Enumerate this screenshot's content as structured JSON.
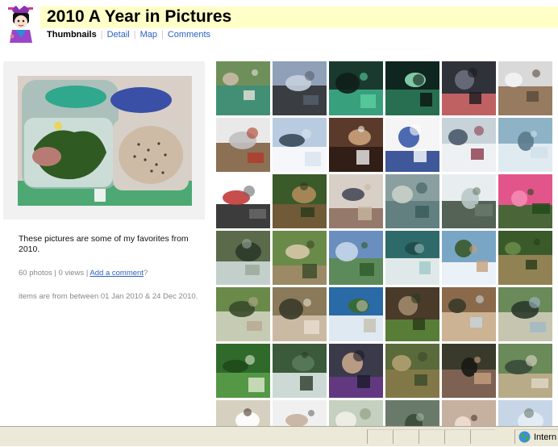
{
  "album": {
    "title": "2010 A Year in Pictures"
  },
  "nav": {
    "thumbnails": "Thumbnails",
    "detail": "Detail",
    "map": "Map",
    "comments": "Comments"
  },
  "sidebar": {
    "description": "These pictures are some of my favorites from 2010.",
    "photo_count": "60 photos",
    "separator": "|",
    "view_count": "0 views",
    "add_comment": "Add a comment",
    "question_mark": "?",
    "date_range": "items are from between 01 Jan 2010 & 24 Dec 2010."
  },
  "status": {
    "zone_label": "Intern"
  },
  "thumbnails": [
    {
      "subject": "food-tubs"
    },
    {
      "subject": "bare-trees-dusk"
    },
    {
      "subject": "green-table-night"
    },
    {
      "subject": "green-porch-night"
    },
    {
      "subject": "sunset-town"
    },
    {
      "subject": "snowy-deck-chairs"
    },
    {
      "subject": "snowy-deck-grill"
    },
    {
      "subject": "snowy-trees"
    },
    {
      "subject": "speaker-podium"
    },
    {
      "subject": "blue-plate"
    },
    {
      "subject": "snowy-hill-group"
    },
    {
      "subject": "icicles"
    },
    {
      "subject": "knit-hat"
    },
    {
      "subject": "forest-boardwalk"
    },
    {
      "subject": "group-dinner"
    },
    {
      "subject": "river-rocks"
    },
    {
      "subject": "waterfall-cascade"
    },
    {
      "subject": "pink-azaleas"
    },
    {
      "subject": "tall-waterfall"
    },
    {
      "subject": "garden-work"
    },
    {
      "subject": "mountain-view-person"
    },
    {
      "subject": "swamp-rabbit-trail-sign"
    },
    {
      "subject": "hikers-group"
    },
    {
      "subject": "forest-bridge"
    },
    {
      "subject": "bench-group"
    },
    {
      "subject": "picnic-group"
    },
    {
      "subject": "girl-reading"
    },
    {
      "subject": "vegetable-garden"
    },
    {
      "subject": "pavilion-group"
    },
    {
      "subject": "friends-outdoors"
    },
    {
      "subject": "zucchini"
    },
    {
      "subject": "forest-stream"
    },
    {
      "subject": "women-smiling"
    },
    {
      "subject": "wasp-nest"
    },
    {
      "subject": "dark-party"
    },
    {
      "subject": "outdoor-meal"
    },
    {
      "subject": "building-porch"
    },
    {
      "subject": "people-row"
    },
    {
      "subject": "garden-rows"
    },
    {
      "subject": "rock-stream"
    },
    {
      "subject": "kid-outdoors"
    },
    {
      "subject": "mountain-spire"
    }
  ]
}
